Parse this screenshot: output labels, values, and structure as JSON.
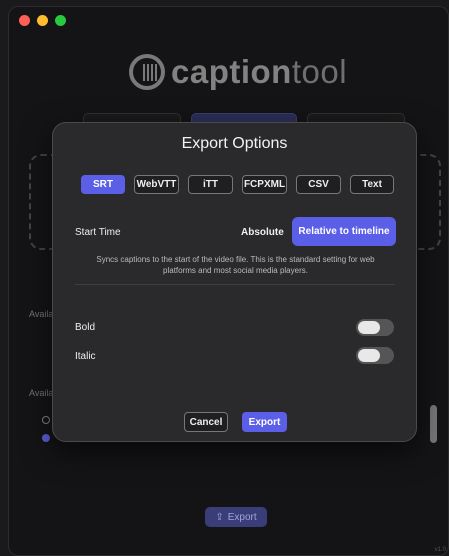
{
  "background": {
    "logo": {
      "bold": "caption",
      "light": "tool"
    },
    "available_label_1": "Availa",
    "available_label_2": "Availa",
    "export_button": "Export",
    "export_icon": "share-icon",
    "version": "v1.0"
  },
  "modal": {
    "title": "Export Options",
    "formats": [
      {
        "label": "SRT",
        "active": true
      },
      {
        "label": "WebVTT",
        "active": false
      },
      {
        "label": "iTT",
        "active": false
      },
      {
        "label": "FCPXML",
        "active": false
      },
      {
        "label": "CSV",
        "active": false
      },
      {
        "label": "Text",
        "active": false
      }
    ],
    "start_time_label": "Start Time",
    "absolute_label": "Absolute",
    "relative_label": "Relative to timeline",
    "description": "Syncs captions to the start of the video file. This is the standard setting for web platforms and most social media players.",
    "bold_label": "Bold",
    "italic_label": "Italic",
    "bold_on": false,
    "italic_on": false,
    "cancel_label": "Cancel",
    "export_label": "Export"
  },
  "colors": {
    "accent": "#5b5fe8",
    "panel": "#2a2a2c",
    "window": "#141416"
  }
}
